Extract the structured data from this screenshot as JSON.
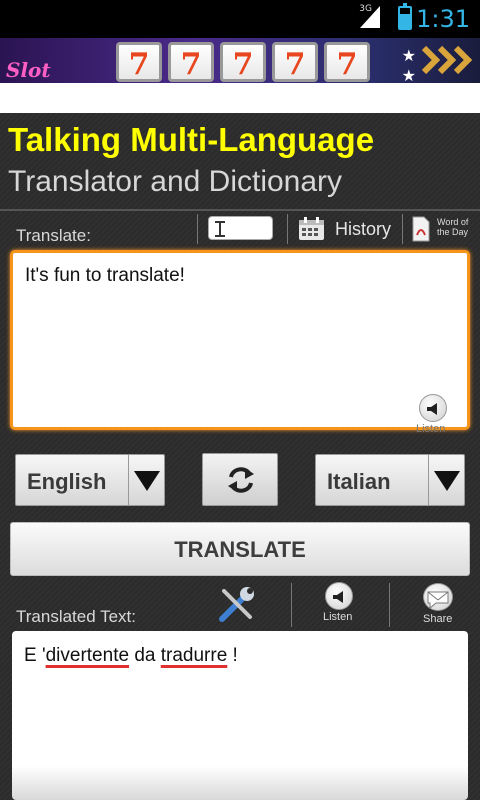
{
  "status_bar": {
    "network_label": "3G",
    "time": "1:31",
    "accent_color": "#33b5e5"
  },
  "ad_banner": {
    "logo_text": "Slot",
    "reel_symbols": [
      "7",
      "7",
      "7",
      "7",
      "7"
    ]
  },
  "app": {
    "title_line1": "Talking Multi-Language",
    "title_line2": "Translator and Dictionary",
    "title_color": "#ffff00"
  },
  "input_section": {
    "label": "Translate:",
    "history_label": "History",
    "word_of_day_label": "Word of the Day",
    "input_text": "It's fun to translate!",
    "listen_caption": "Listen",
    "border_color": "#f7941d"
  },
  "language_bar": {
    "source_language": "English",
    "target_language": "Italian"
  },
  "translate_button_label": "TRANSLATE",
  "output_section": {
    "label": "Translated Text:",
    "listen_caption": "Listen",
    "share_caption": "Share",
    "output_parts": [
      "E '",
      "divertente",
      " da ",
      "tradurre",
      " !"
    ]
  }
}
